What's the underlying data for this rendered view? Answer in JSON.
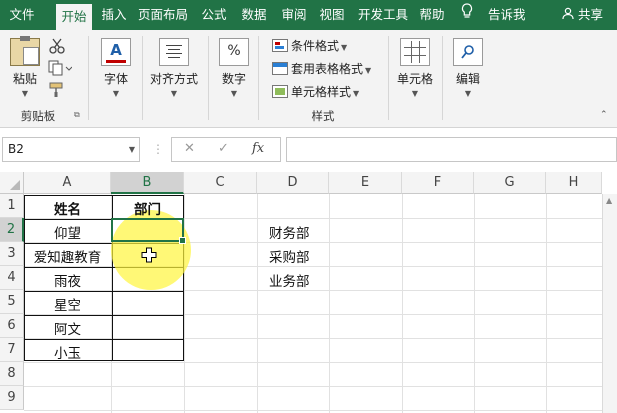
{
  "ribbon_tabs": [
    "文件",
    "开始",
    "插入",
    "页面布局",
    "公式",
    "数据",
    "审阅",
    "视图",
    "开发工具",
    "帮助"
  ],
  "active_tab": "开始",
  "tell_me": "告诉我",
  "share": "共享",
  "clipboard": {
    "paste": "粘贴",
    "group_label": "剪贴板"
  },
  "font_group": {
    "label": "字体"
  },
  "align_group": {
    "label": "对齐方式"
  },
  "number_group": {
    "label": "数字",
    "icon_text": "%"
  },
  "styles": {
    "conditional": "条件格式",
    "table_format": "套用表格格式",
    "cell_styles": "单元格样式",
    "group_label": "样式"
  },
  "cells_group": {
    "label": "单元格"
  },
  "editing_group": {
    "label": "编辑"
  },
  "name_box": "B2",
  "fx_label": "fx",
  "columns": [
    "A",
    "B",
    "C",
    "D",
    "E",
    "F",
    "G",
    "H"
  ],
  "rows": [
    "1",
    "2",
    "3",
    "4",
    "5",
    "6",
    "7",
    "8",
    "9"
  ],
  "selected_column": "B",
  "selected_row": "2",
  "table": {
    "header_name": "姓名",
    "header_dept": "部门",
    "names": [
      "仰望",
      "爱知趣教育",
      "雨夜",
      "星空",
      "阿文",
      "小玉"
    ]
  },
  "dept_list": [
    "财务部",
    "采购部",
    "业务部"
  ],
  "colors": {
    "brand": "#217346"
  }
}
